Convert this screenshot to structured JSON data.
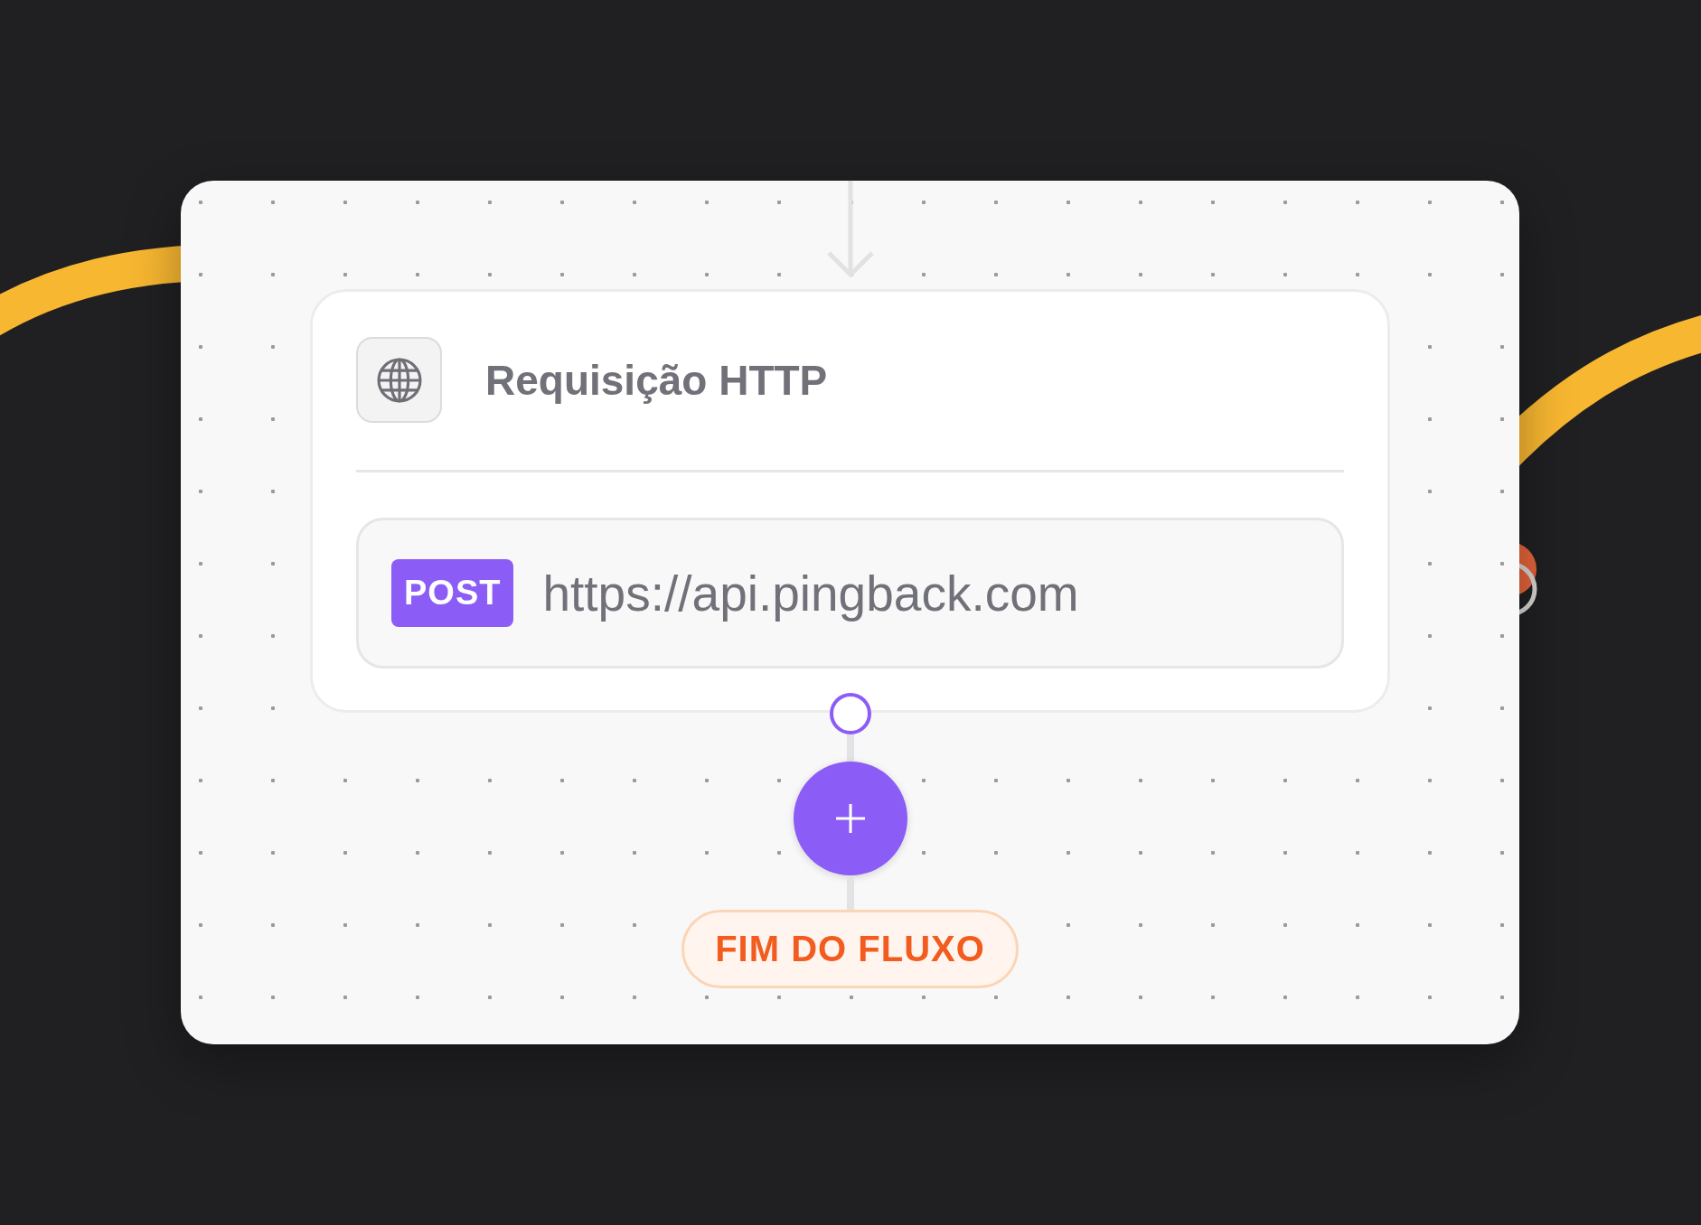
{
  "node": {
    "title": "Requisição HTTP",
    "method": "POST",
    "url": "https://api.pingback.com"
  },
  "end_label": "FIM DO FLUXO"
}
